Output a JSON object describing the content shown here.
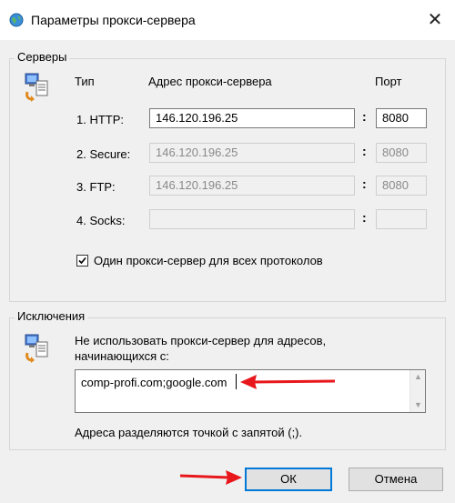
{
  "window": {
    "title": "Параметры прокси-сервера",
    "close_glyph": "✕"
  },
  "servers": {
    "legend": "Серверы",
    "col_type": "Тип",
    "col_address": "Адрес прокси-сервера",
    "col_port": "Порт",
    "separator": ":",
    "rows": [
      {
        "label": "1. HTTP:",
        "address": "146.120.196.25",
        "port": "8080",
        "enabled": true
      },
      {
        "label": "2. Secure:",
        "address": "146.120.196.25",
        "port": "8080",
        "enabled": false
      },
      {
        "label": "3. FTP:",
        "address": "146.120.196.25",
        "port": "8080",
        "enabled": false
      },
      {
        "label": "4. Socks:",
        "address": "",
        "port": "",
        "enabled": false
      }
    ],
    "same_proxy_label": "Один прокси-сервер для всех протоколов",
    "same_proxy_checked": true
  },
  "exceptions": {
    "legend": "Исключения",
    "description_line1": "Не использовать прокси-сервер для адресов,",
    "description_line2": "начинающихся с:",
    "value": "comp-profi.com;google.com",
    "hint": "Адреса разделяются точкой с запятой (;)."
  },
  "buttons": {
    "ok": "ОК",
    "cancel": "Отмена"
  },
  "colors": {
    "annotation_arrow": "#e8171b",
    "default_button_border": "#0078d7"
  }
}
